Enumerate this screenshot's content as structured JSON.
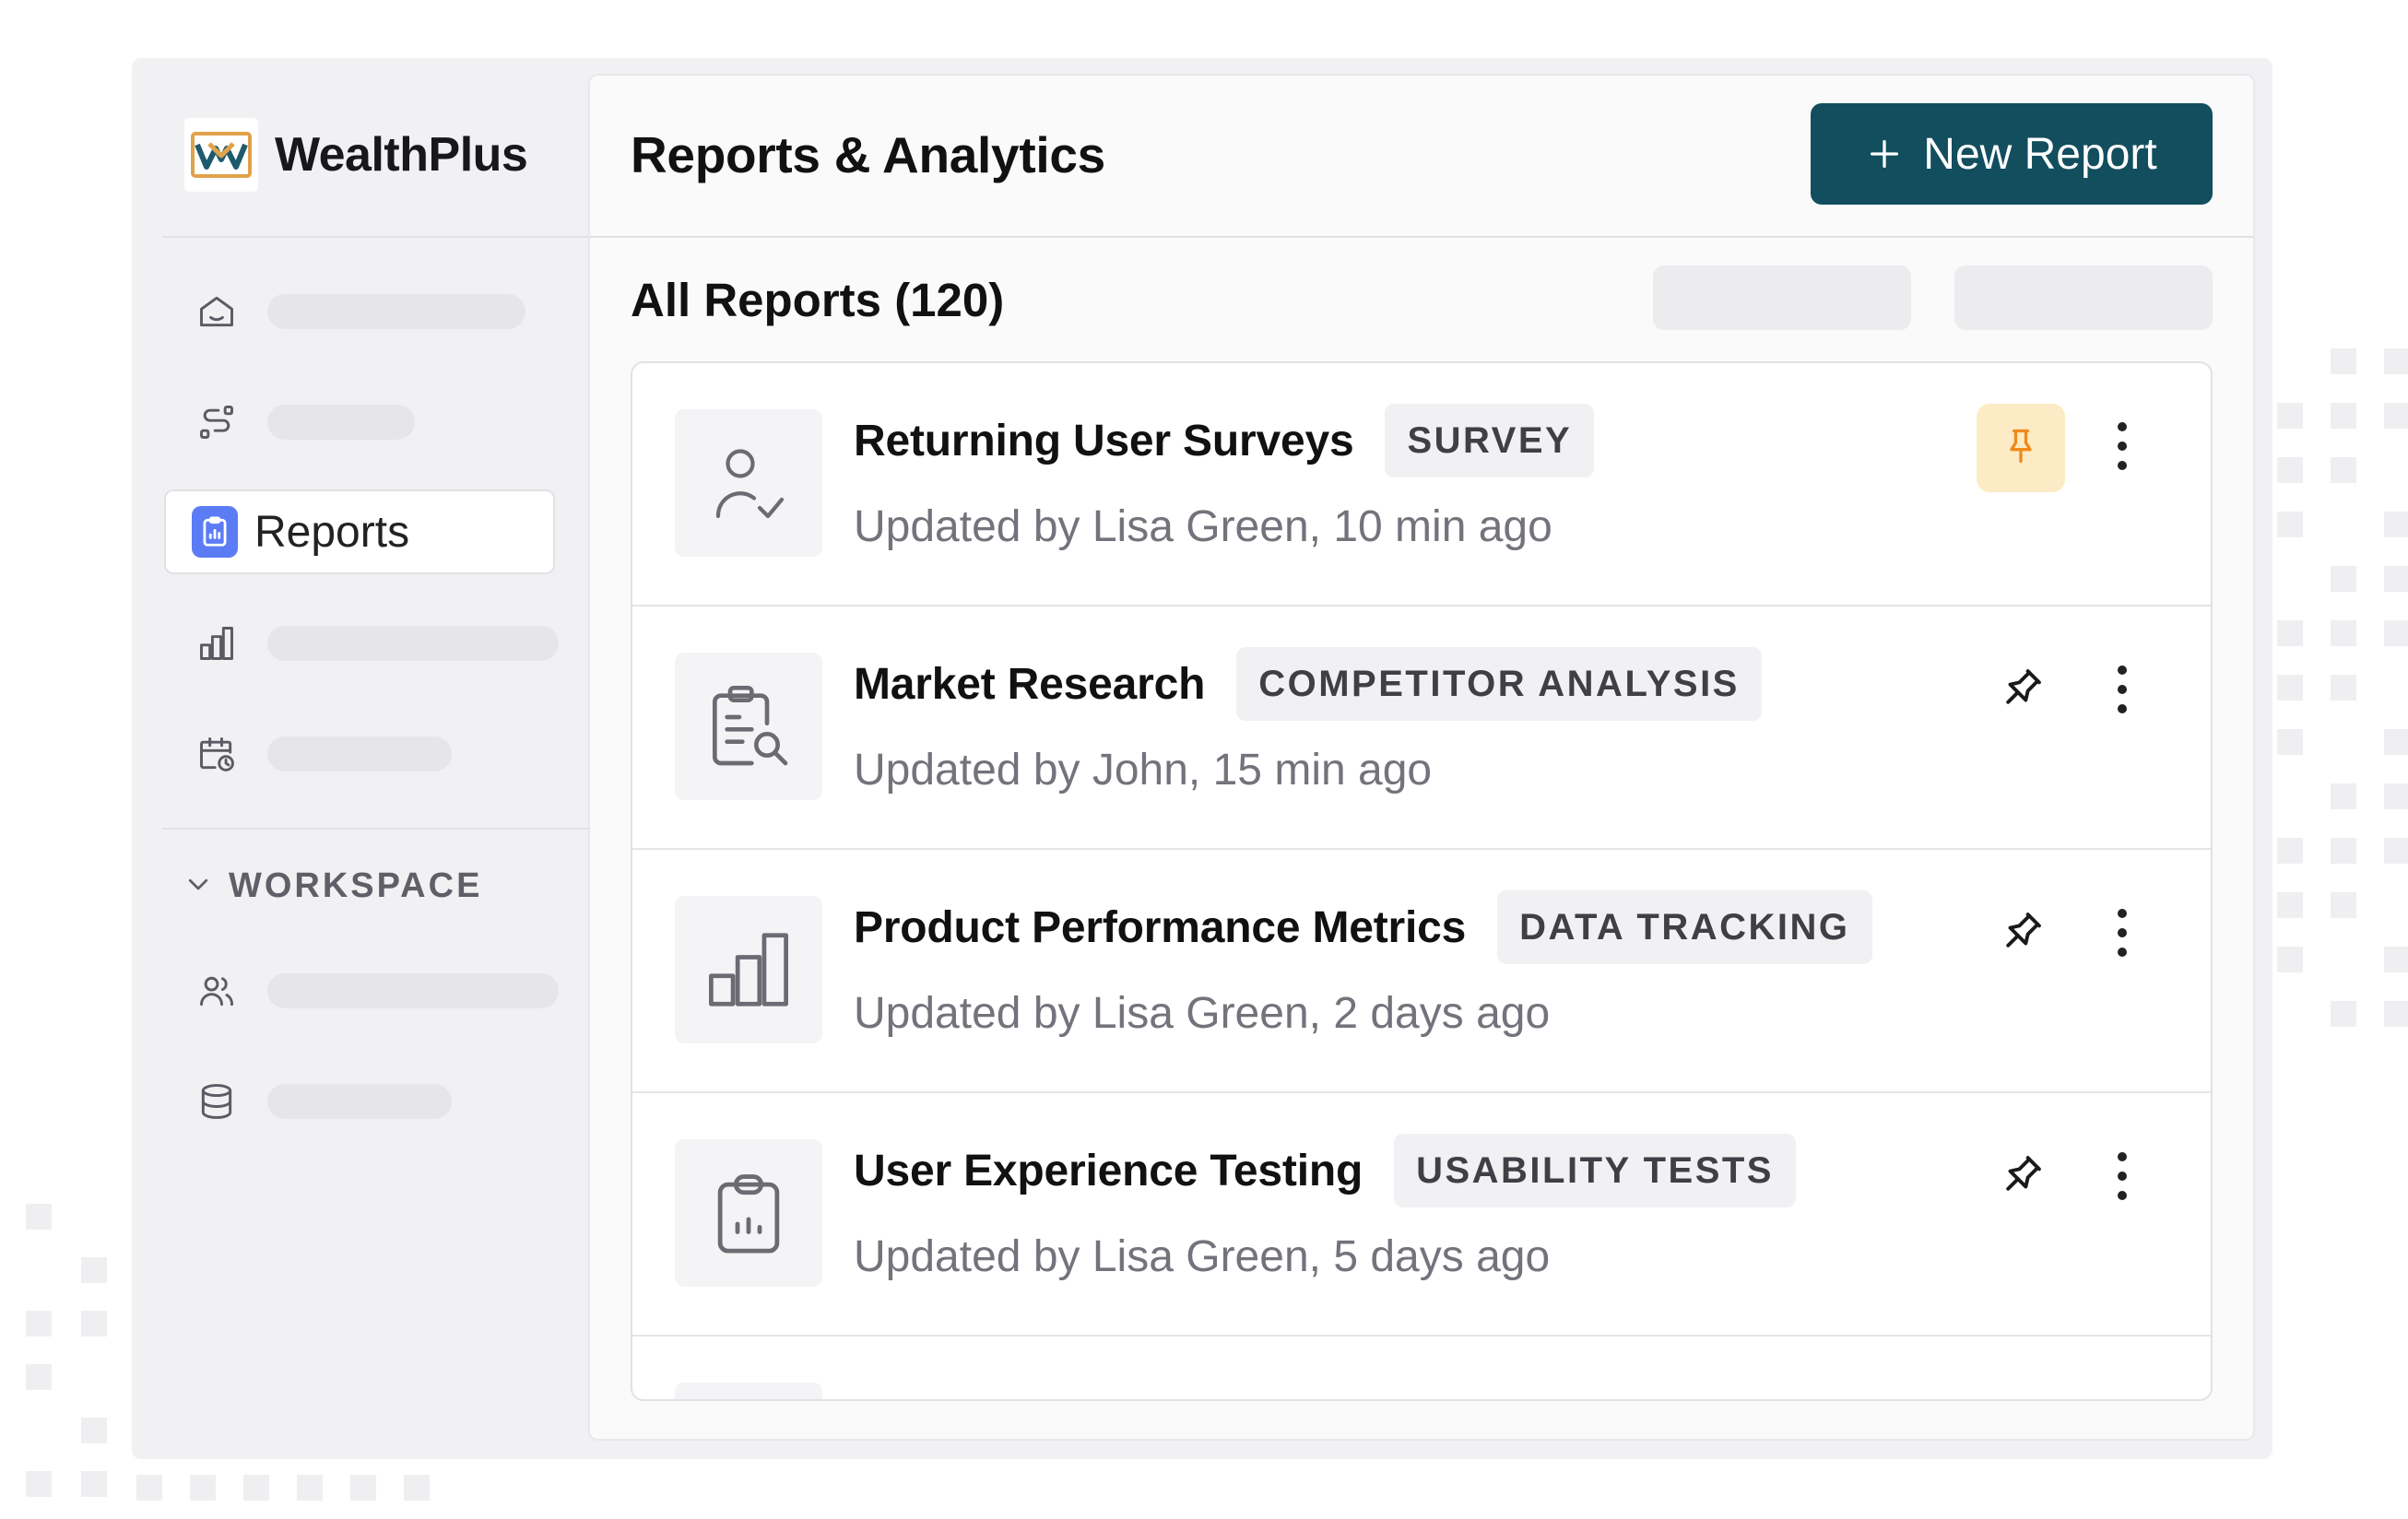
{
  "app": {
    "name": "WealthPlus",
    "page_title": "Reports & Analytics",
    "new_report_label": "New Report"
  },
  "sidebar": {
    "items": [
      {
        "icon": "home-icon"
      },
      {
        "icon": "route-icon"
      },
      {
        "icon": "clipboard-chart-icon",
        "label": "Reports",
        "active": true
      },
      {
        "icon": "bar-chart-icon"
      },
      {
        "icon": "calendar-clock-icon"
      }
    ],
    "workspace_title": "WORKSPACE",
    "workspace_items": [
      {
        "icon": "users-icon"
      },
      {
        "icon": "database-icon"
      }
    ]
  },
  "reports": {
    "heading": "All Reports (120)",
    "items": [
      {
        "title": "Returning User Surveys",
        "tag": "SURVEY",
        "meta": "Updated by Lisa Green, 10 min ago",
        "pinned": true,
        "icon": "user-check-icon"
      },
      {
        "title": "Market Research",
        "tag": "COMPETITOR ANALYSIS",
        "meta": "Updated by John, 15 min ago",
        "pinned": false,
        "icon": "clipboard-search-icon"
      },
      {
        "title": "Product Performance Metrics",
        "tag": "DATA TRACKING",
        "meta": "Updated by Lisa Green, 2 days ago",
        "pinned": false,
        "icon": "bar-chart-icon"
      },
      {
        "title": "User Experience Testing",
        "tag": "USABILITY TESTS",
        "meta": "Updated by Lisa Green, 5 days ago",
        "pinned": false,
        "icon": "clipboard-chart-icon"
      }
    ]
  },
  "colors": {
    "primary": "#134e5e",
    "active_nav_icon": "#5b7cf5",
    "pinned_bg": "#fdebc5",
    "pinned_icon": "#f08a1a"
  }
}
